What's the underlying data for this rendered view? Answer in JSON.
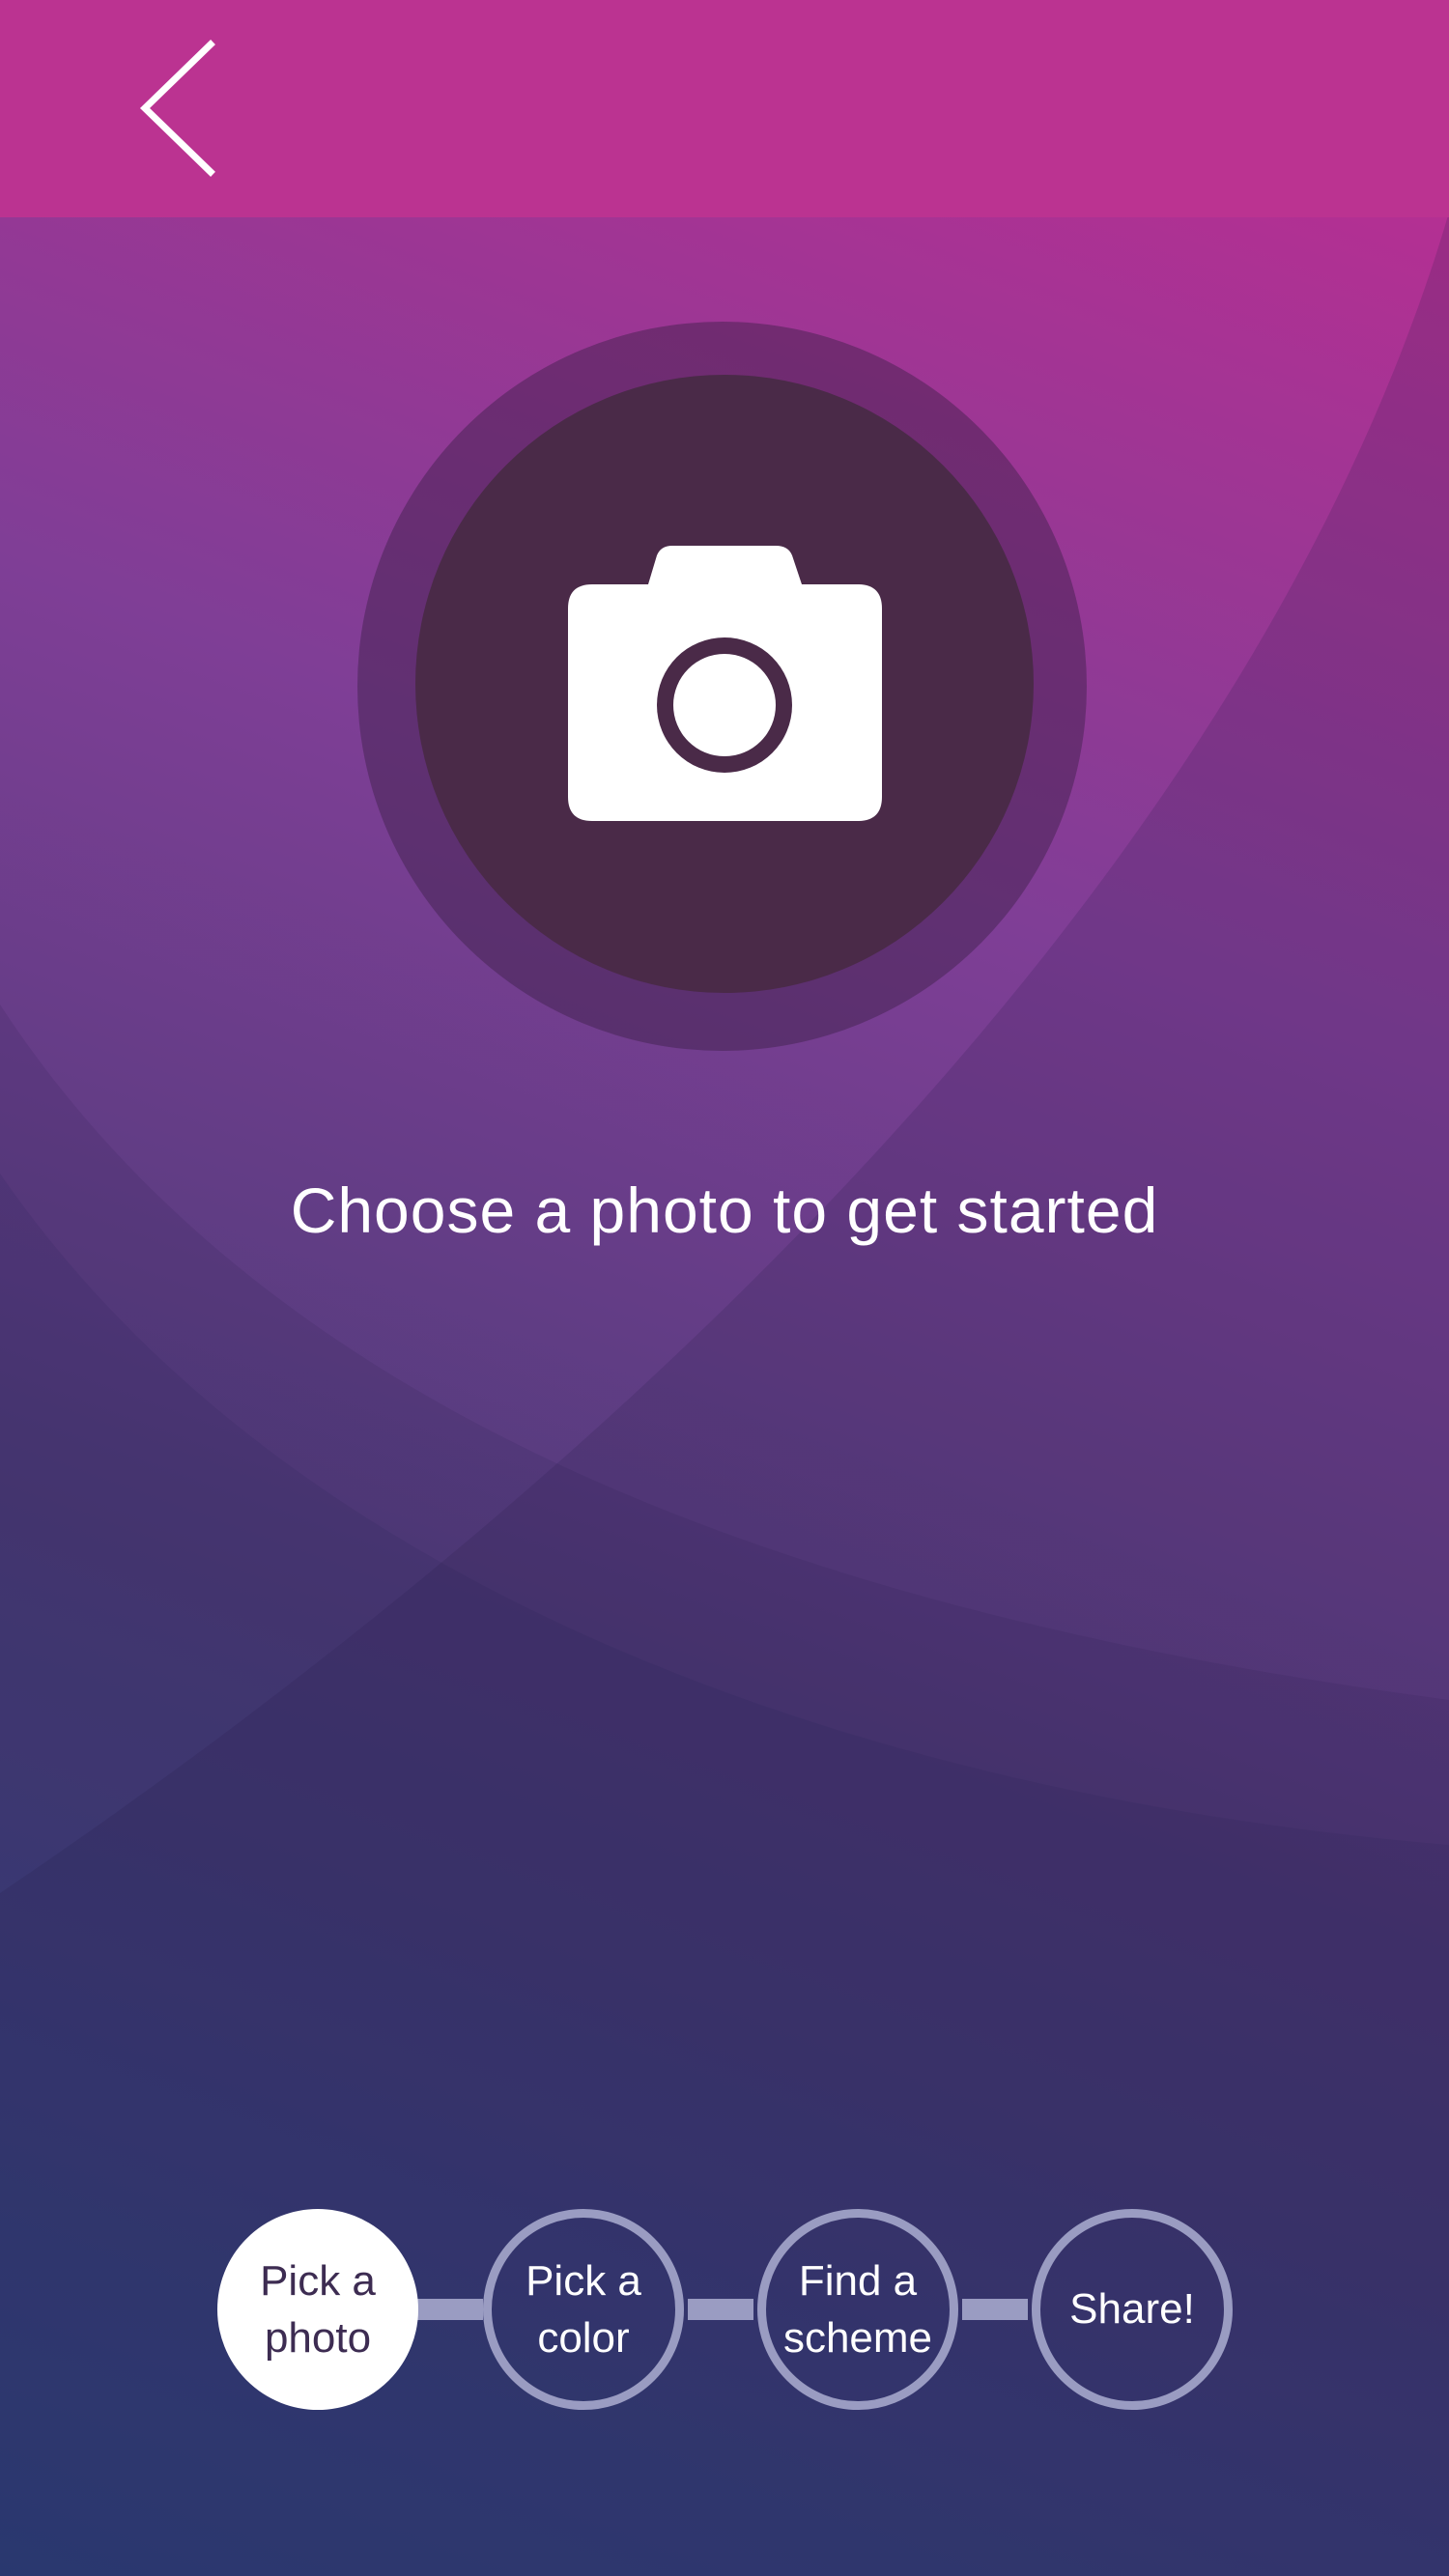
{
  "header": {
    "back_icon": "chevron-left-icon"
  },
  "camera": {
    "icon": "camera-icon"
  },
  "prompt": "Choose a photo to get started",
  "steps": [
    {
      "label": "Pick a photo",
      "line1": "Pick a",
      "line2": "photo",
      "active": true
    },
    {
      "label": "Pick a color",
      "line1": "Pick a",
      "line2": "color",
      "active": false
    },
    {
      "label": "Find a scheme",
      "line1": "Find a",
      "line2": "scheme",
      "active": false
    },
    {
      "label": "Share!",
      "line1": "Share!",
      "line2": "",
      "active": false
    }
  ],
  "colors": {
    "top_bar": "#bb3391",
    "camera_disc": "#4a2a48",
    "step_ring": "#9a9cc2"
  }
}
